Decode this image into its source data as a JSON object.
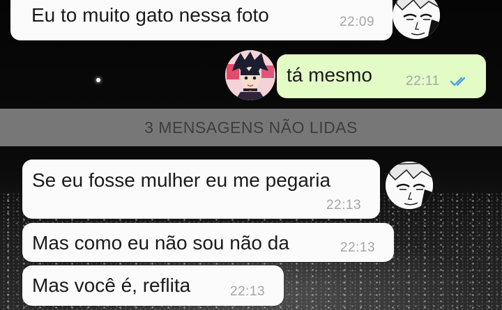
{
  "messages": [
    {
      "text": "Eu to muito gato nessa foto",
      "time": "22:09",
      "direction": "incoming"
    },
    {
      "text": "tá mesmo",
      "time": "22:11",
      "direction": "outgoing",
      "status": "read"
    },
    {
      "text": "Se eu fosse mulher eu me pegaria",
      "time": "22:13",
      "direction": "incoming"
    },
    {
      "text": "Mas como eu não sou não da",
      "time": "22:13",
      "direction": "incoming"
    },
    {
      "text": "Mas você é, reflita",
      "time": "22:13",
      "direction": "incoming"
    }
  ],
  "unread_divider": {
    "label": "3 MENSAGENS NÃO LIDAS"
  },
  "colors": {
    "incoming_bubble": "#fbfbfb",
    "outgoing_bubble": "#e3fcc6",
    "read_ticks": "#4fa3e0"
  },
  "icons": {
    "read_status": "double-check-icon",
    "avatar_contact": "manga-character-avatar",
    "avatar_self": "anime-character-avatar"
  }
}
